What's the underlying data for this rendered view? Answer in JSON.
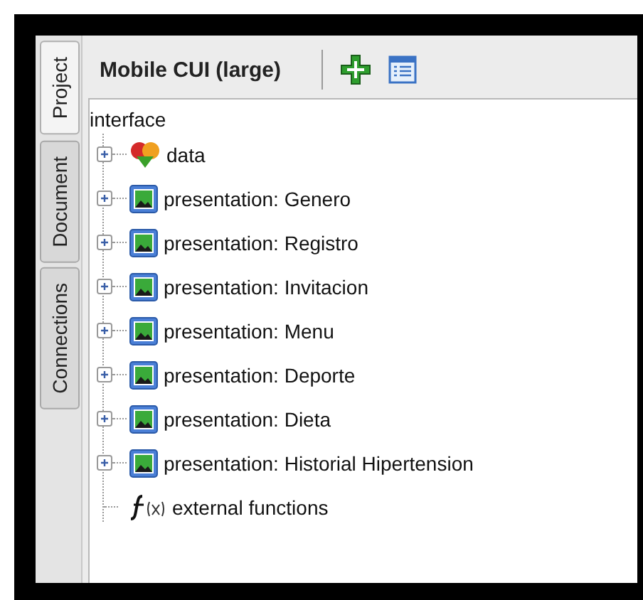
{
  "side_tabs": [
    {
      "label": "Project",
      "selected": true
    },
    {
      "label": "Document",
      "selected": false
    },
    {
      "label": "Connections",
      "selected": false
    }
  ],
  "panel": {
    "title": "Mobile CUI (large)"
  },
  "tree": {
    "label": "interface",
    "children": [
      {
        "label": "data",
        "kind": "data",
        "expanded": false
      },
      {
        "label": "presentation: Genero",
        "kind": "presentation",
        "expanded": false
      },
      {
        "label": "presentation: Registro",
        "kind": "presentation",
        "expanded": false
      },
      {
        "label": "presentation: Invitacion",
        "kind": "presentation",
        "expanded": false
      },
      {
        "label": "presentation: Menu",
        "kind": "presentation",
        "expanded": false
      },
      {
        "label": "presentation: Deporte",
        "kind": "presentation",
        "expanded": false
      },
      {
        "label": "presentation: Dieta",
        "kind": "presentation",
        "expanded": false
      },
      {
        "label": "presentation: Historial Hipertension",
        "kind": "presentation",
        "expanded": false
      },
      {
        "label": "external functions",
        "kind": "function"
      }
    ]
  }
}
